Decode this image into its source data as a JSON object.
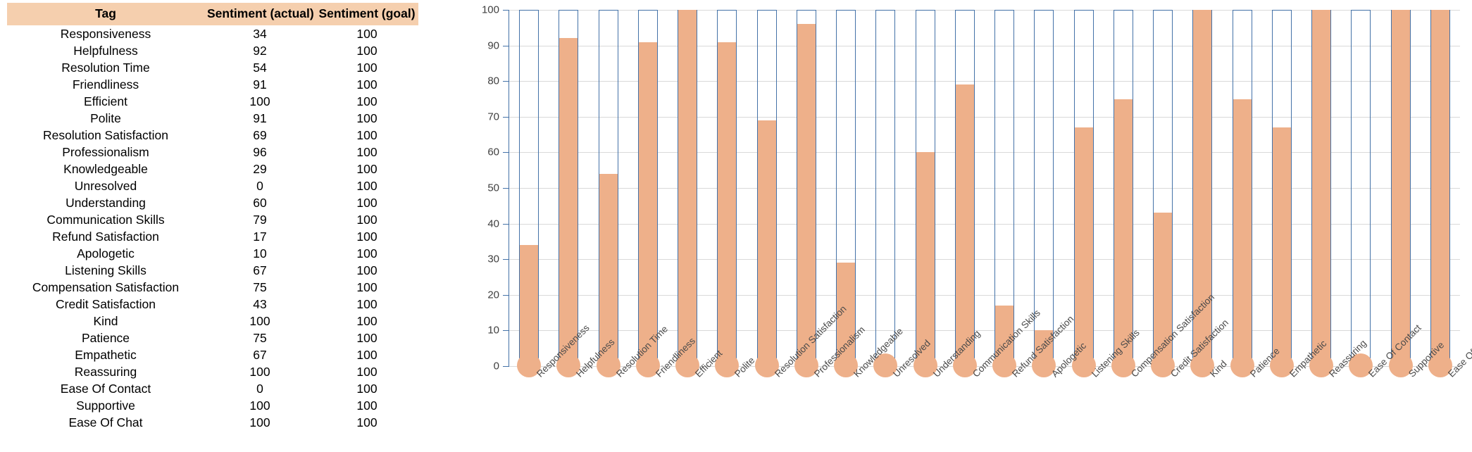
{
  "table": {
    "headers": [
      "Tag",
      "Sentiment (actual)",
      "Sentiment (goal)"
    ],
    "header_bg": "#f5cfae",
    "rows": [
      {
        "tag": "Responsiveness",
        "actual": 34,
        "goal": 100
      },
      {
        "tag": "Helpfulness",
        "actual": 92,
        "goal": 100
      },
      {
        "tag": "Resolution Time",
        "actual": 54,
        "goal": 100
      },
      {
        "tag": "Friendliness",
        "actual": 91,
        "goal": 100
      },
      {
        "tag": "Efficient",
        "actual": 100,
        "goal": 100
      },
      {
        "tag": "Polite",
        "actual": 91,
        "goal": 100
      },
      {
        "tag": "Resolution Satisfaction",
        "actual": 69,
        "goal": 100
      },
      {
        "tag": "Professionalism",
        "actual": 96,
        "goal": 100
      },
      {
        "tag": "Knowledgeable",
        "actual": 29,
        "goal": 100
      },
      {
        "tag": "Unresolved",
        "actual": 0,
        "goal": 100
      },
      {
        "tag": "Understanding",
        "actual": 60,
        "goal": 100
      },
      {
        "tag": "Communication Skills",
        "actual": 79,
        "goal": 100
      },
      {
        "tag": "Refund Satisfaction",
        "actual": 17,
        "goal": 100
      },
      {
        "tag": "Apologetic",
        "actual": 10,
        "goal": 100
      },
      {
        "tag": "Listening Skills",
        "actual": 67,
        "goal": 100
      },
      {
        "tag": "Compensation Satisfaction",
        "actual": 75,
        "goal": 100
      },
      {
        "tag": "Credit Satisfaction",
        "actual": 43,
        "goal": 100
      },
      {
        "tag": "Kind",
        "actual": 100,
        "goal": 100
      },
      {
        "tag": "Patience",
        "actual": 75,
        "goal": 100
      },
      {
        "tag": "Empathetic",
        "actual": 67,
        "goal": 100
      },
      {
        "tag": "Reassuring",
        "actual": 100,
        "goal": 100
      },
      {
        "tag": "Ease Of Contact",
        "actual": 0,
        "goal": 100
      },
      {
        "tag": "Supportive",
        "actual": 100,
        "goal": 100
      },
      {
        "tag": "Ease Of Chat",
        "actual": 100,
        "goal": 100
      }
    ]
  },
  "chart_data": {
    "type": "bar",
    "title": "",
    "xlabel": "",
    "ylabel": "",
    "ylim": [
      0,
      100
    ],
    "yticks": [
      0,
      10,
      20,
      30,
      40,
      50,
      60,
      70,
      80,
      90,
      100
    ],
    "grid": true,
    "legend": "none",
    "style": "thermometer",
    "colors": {
      "actual_fill": "#eeb08a",
      "goal_outline": "#4472a8",
      "gridline": "#d9d9d9",
      "tick_text": "#3f3f3f",
      "label_text": "#4a4a4a"
    },
    "categories": [
      "Responsiveness",
      "Helpfulness",
      "Resolution Time",
      "Friendliness",
      "Efficient",
      "Polite",
      "Resolution Satisfaction",
      "Professionalism",
      "Knowledgeable",
      "Unresolved",
      "Understanding",
      "Communication Skills",
      "Refund Satisfaction",
      "Apologetic",
      "Listening Skills",
      "Compensation Satisfaction",
      "Credit Satisfaction",
      "Kind",
      "Patience",
      "Empathetic",
      "Reassuring",
      "Ease Of Contact",
      "Supportive",
      "Ease Of Chat"
    ],
    "series": [
      {
        "name": "Sentiment (actual)",
        "values": [
          34,
          92,
          54,
          91,
          100,
          91,
          69,
          96,
          29,
          0,
          60,
          79,
          17,
          10,
          67,
          75,
          43,
          100,
          75,
          67,
          100,
          0,
          100,
          100
        ]
      },
      {
        "name": "Sentiment (goal)",
        "values": [
          100,
          100,
          100,
          100,
          100,
          100,
          100,
          100,
          100,
          100,
          100,
          100,
          100,
          100,
          100,
          100,
          100,
          100,
          100,
          100,
          100,
          100,
          100,
          100
        ]
      }
    ]
  }
}
